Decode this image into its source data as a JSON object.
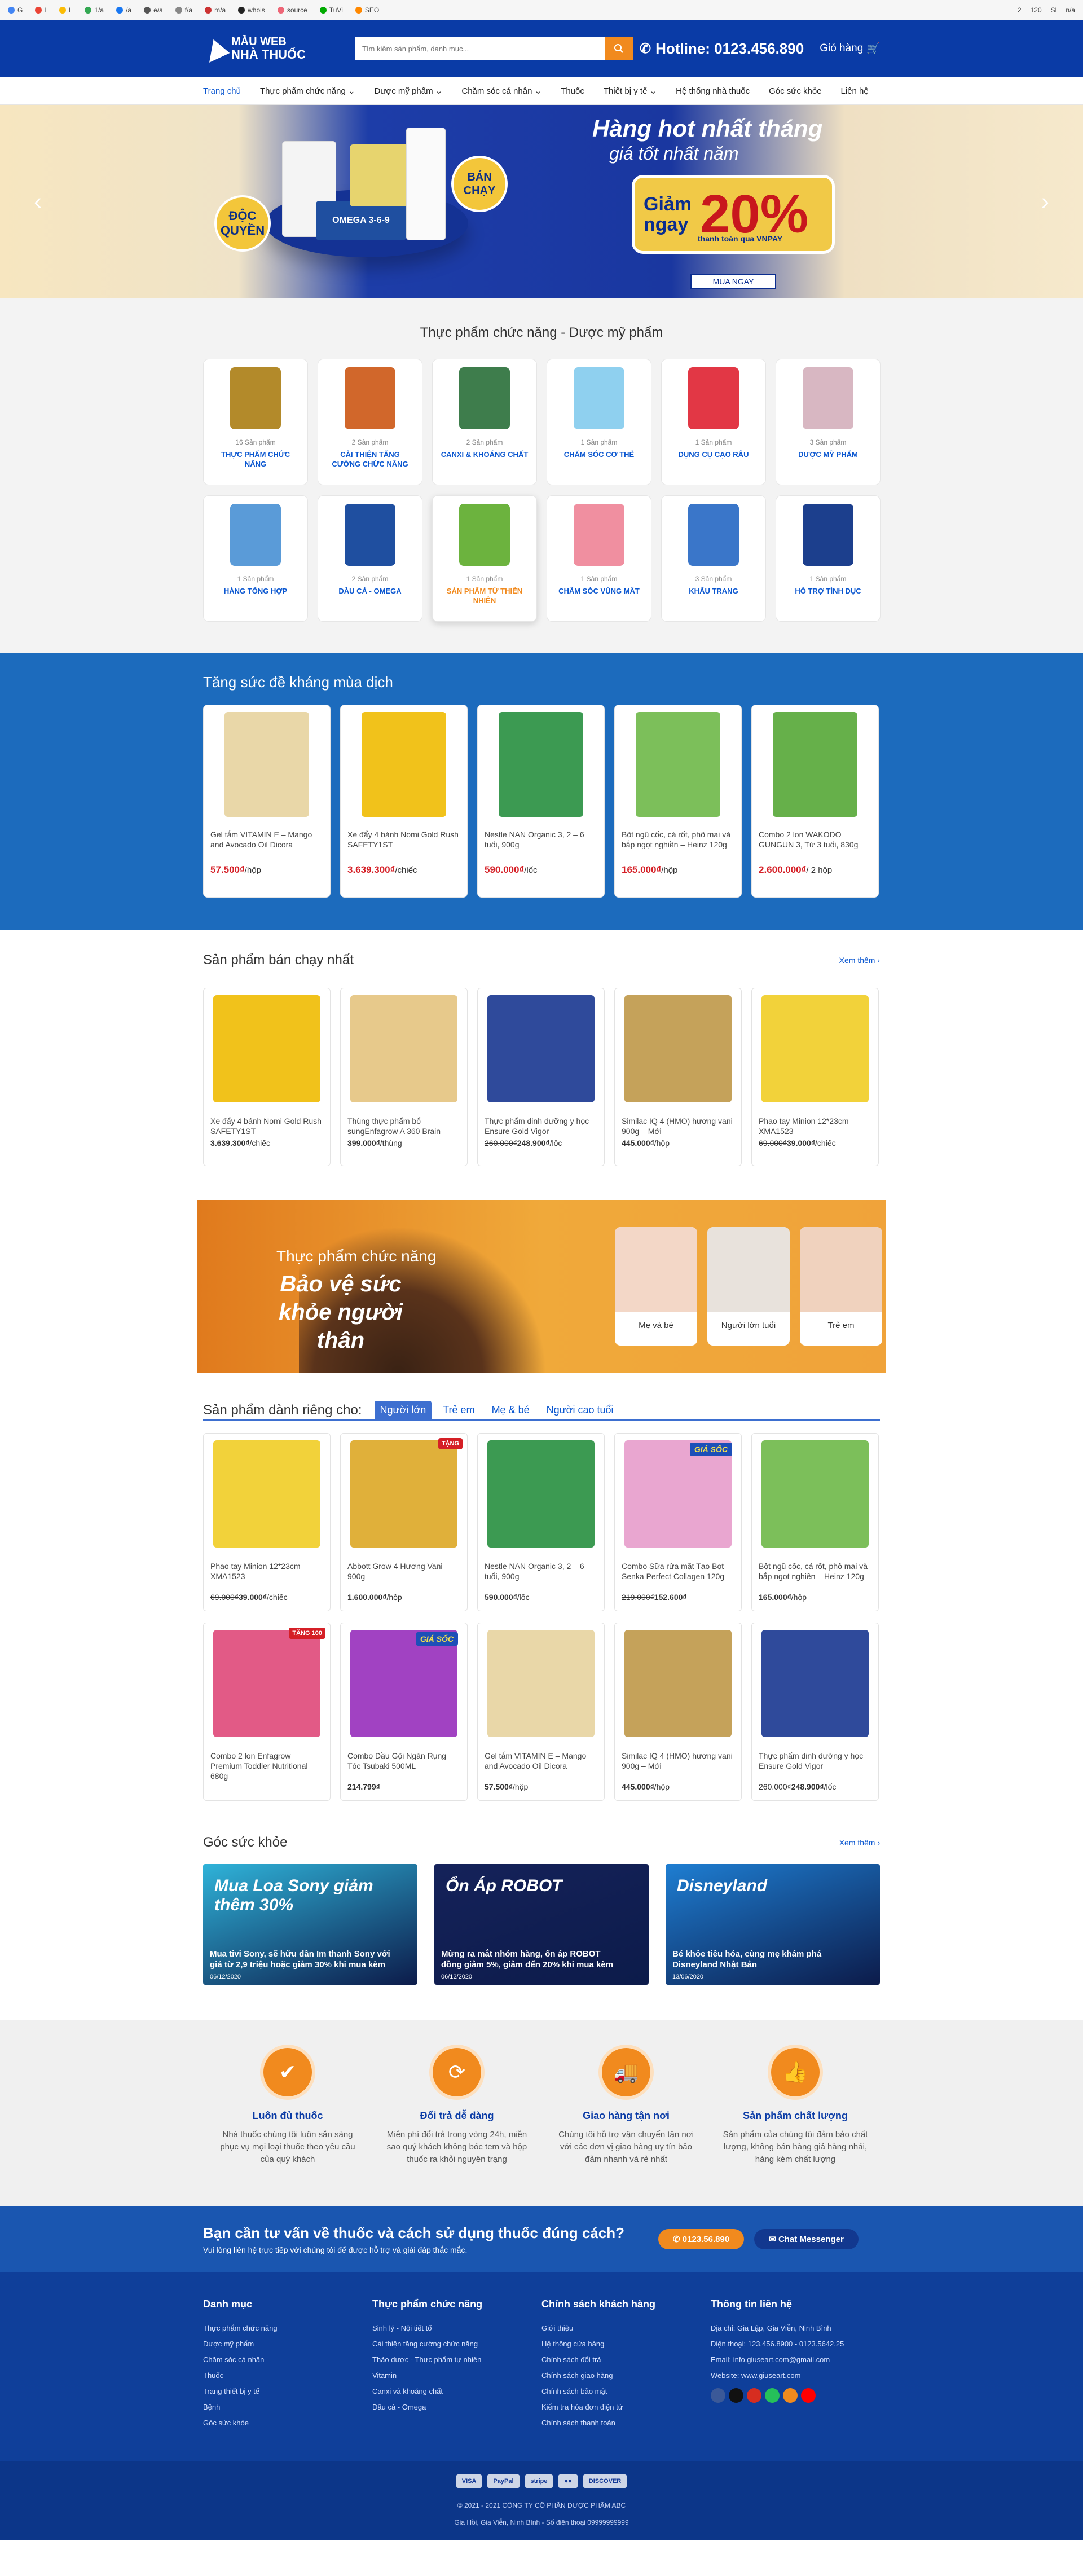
{
  "bookmarks": [
    "G",
    "I",
    "L",
    "1/a",
    "/a",
    "e/a",
    "f/a",
    "m/a",
    "whois",
    "source",
    "TuVi",
    "SEO"
  ],
  "bookmarks_right": [
    "2",
    "120",
    "Sl",
    "n/a"
  ],
  "header": {
    "logo_line1": "MẪU WEB",
    "logo_line2": "NHÀ THUỐC",
    "search_placeholder": "Tìm kiếm sản phẩm, danh mục...",
    "hotline": "Hotline: 0123.456.890",
    "cart": "Giỏ hàng"
  },
  "nav": [
    "Trang chủ",
    "Thực phẩm chức năng ⌄",
    "Dược mỹ phẩm ⌄",
    "Chăm sóc cá nhân ⌄",
    "Thuốc",
    "Thiết bị y tế ⌄",
    "Hệ thống nhà thuốc",
    "Góc sức khỏe",
    "Liên hệ"
  ],
  "banner": {
    "badge_left": "ĐỘC QUYỀN",
    "badge_right": "BÁN CHẠY",
    "headline": "Hàng hot nhất tháng",
    "subline": "giá tốt nhất năm",
    "promo_word": "Giảm ngay",
    "promo_value": "20%",
    "promo_note": "thanh toán qua VNPAY",
    "cta": "MUA NGAY",
    "product_label": "OMEGA 3-6-9"
  },
  "categories_title": "Thực phẩm chức năng - Dược mỹ phẩm",
  "categories": [
    {
      "count": "16 Sản phẩm",
      "name": "THỰC PHẨM CHỨC NĂNG",
      "color": "#b38a2a"
    },
    {
      "count": "2 Sản phẩm",
      "name": "CẢI THIỆN TĂNG CƯỜNG CHỨC NĂNG",
      "color": "#d1672b"
    },
    {
      "count": "2 Sản phẩm",
      "name": "CANXI & KHOÁNG CHẤT",
      "color": "#3e7d4c"
    },
    {
      "count": "1 Sản phẩm",
      "name": "CHĂM SÓC CƠ THỂ",
      "color": "#8fd0ef"
    },
    {
      "count": "1 Sản phẩm",
      "name": "DỤNG CỤ CẠO RÂU",
      "color": "#e23745"
    },
    {
      "count": "3 Sản phẩm",
      "name": "DƯỢC MỸ PHẨM",
      "color": "#d8b7c2"
    },
    {
      "count": "1 Sản phẩm",
      "name": "HÀNG TỔNG HỢP",
      "color": "#5a9bd8"
    },
    {
      "count": "2 Sản phẩm",
      "name": "DẦU CÁ - OMEGA",
      "color": "#1f4fa0"
    },
    {
      "count": "1 Sản phẩm",
      "name": "SẢN PHẨM TỪ THIÊN NHIÊN",
      "color": "#6cb33e",
      "active": true
    },
    {
      "count": "1 Sản phẩm",
      "name": "CHĂM SÓC VÙNG MẮT",
      "color": "#f08fa0"
    },
    {
      "count": "3 Sản phẩm",
      "name": "KHẨU TRANG",
      "color": "#3a76c9"
    },
    {
      "count": "1 Sản phẩm",
      "name": "HỖ TRỢ TÌNH DỤC",
      "color": "#1c3f8d"
    }
  ],
  "immunity": {
    "title": "Tăng sức đề kháng mùa dịch",
    "items": [
      {
        "name": "Gel tắm VITAMIN E – Mango and Avocado Oil Dicora",
        "price": "57.500₫",
        "unit": "/hộp",
        "color": "#e9d7a8"
      },
      {
        "name": "Xe đẩy 4 bánh Nomi Gold Rush SAFETY1ST",
        "price": "3.639.300₫",
        "unit": "/chiếc",
        "color": "#f1c21b"
      },
      {
        "name": "Nestle NAN Organic 3, 2 – 6 tuổi, 900g",
        "price": "590.000₫",
        "unit": "/lốc",
        "color": "#3c9a52"
      },
      {
        "name": "Bột ngũ cốc, cá rốt, phô mai và bắp ngọt nghiền – Heinz 120g",
        "price": "165.000₫",
        "unit": "/hộp",
        "color": "#7cbf5a"
      },
      {
        "name": "Combo 2 lon WAKODO GUNGUN 3, Từ 3 tuổi, 830g",
        "price": "2.600.000₫",
        "unit": "/ 2 hộp",
        "color": "#66b04a"
      }
    ]
  },
  "bestsellers": {
    "title": "Sản phẩm bán chạy nhất",
    "more": "Xem thêm ›",
    "items": [
      {
        "name": "Xe đẩy 4 bánh Nomi Gold Rush SAFETY1ST",
        "old": "",
        "price": "3.639.300₫",
        "unit": "/chiếc",
        "color": "#f1c21b"
      },
      {
        "name": "Thùng thực phẩm bổ sungEnfagrow A 360 Brain",
        "old": "",
        "price": "399.000₫",
        "unit": "/thùng",
        "color": "#e7c98b"
      },
      {
        "name": "Thực phẩm dinh dưỡng y học Ensure Gold Vigor",
        "old": "260.000₫",
        "price": "248.900₫",
        "unit": "/lốc",
        "color": "#2f4a9b"
      },
      {
        "name": "Similac IQ 4 (HMO) hương vani 900g – Mới",
        "old": "",
        "price": "445.000₫",
        "unit": "/hộp",
        "color": "#c5a25a"
      },
      {
        "name": "Phao tay Minion 12*23cm XMA1523",
        "old": "69.000₫",
        "price": "39.000₫",
        "unit": "/chiếc",
        "color": "#f2d23a"
      }
    ]
  },
  "family": {
    "line1": "Thực phẩm chức năng",
    "line2": "Bảo vệ sức khỏe người thân",
    "cards": [
      "Mẹ và bé",
      "Người lớn tuổi",
      "Trẻ em"
    ]
  },
  "dedicated": {
    "title": "Sản phẩm dành riêng cho:",
    "tabs": [
      "Người lớn",
      "Trẻ em",
      "Mẹ & bé",
      "Người cao tuổi"
    ],
    "items": [
      {
        "name": "Phao tay Minion 12*23cm XMA1523",
        "old": "69.000₫",
        "price": "39.000₫",
        "unit": "/chiếc",
        "color": "#f2d23a",
        "badge": ""
      },
      {
        "name": "Abbott Grow 4 Hương Vani 900g",
        "old": "",
        "price": "1.600.000₫",
        "unit": "/hộp",
        "color": "#e0b03a",
        "badge": "TẶNG"
      },
      {
        "name": "Nestle NAN Organic 3, 2 – 6 tuổi, 900g",
        "old": "",
        "price": "590.000₫",
        "unit": "/lốc",
        "color": "#3c9a52",
        "badge": ""
      },
      {
        "name": "Combo Sữa rửa mặt Tạo Bọt Senka Perfect Collagen 120g",
        "old": "219.000₫",
        "price": "152.600₫",
        "unit": "",
        "color": "#e9a6d0",
        "badge": "GIÁ SỐC"
      },
      {
        "name": "Bột ngũ cốc, cá rốt, phô mai và bắp ngọt nghiền – Heinz 120g",
        "old": "",
        "price": "165.000₫",
        "unit": "/hộp",
        "color": "#7cbf5a",
        "badge": ""
      },
      {
        "name": "Combo 2 lon Enfagrow Premium Toddler Nutritional 680g",
        "old": "",
        "price": "",
        "unit": "",
        "color": "#e25a86",
        "badge": "TẶNG 100"
      },
      {
        "name": "Combo Dầu Gội Ngăn Rụng Tóc Tsubaki 500ML",
        "old": "",
        "price": "214.799₫",
        "unit": "",
        "color": "#a142c2",
        "badge": "GIÁ SỐC"
      },
      {
        "name": "Gel tắm VITAMIN E – Mango and Avocado Oil Dicora",
        "old": "",
        "price": "57.500₫",
        "unit": "/hộp",
        "color": "#e9d7a8",
        "badge": ""
      },
      {
        "name": "Similac IQ 4 (HMO) hương vani 900g – Mới",
        "old": "",
        "price": "445.000₫",
        "unit": "/hộp",
        "color": "#c5a25a",
        "badge": ""
      },
      {
        "name": "Thực phẩm dinh dưỡng y học Ensure Gold Vigor",
        "old": "260.000₫",
        "price": "248.900₫",
        "unit": "/lốc",
        "color": "#2f4a9b",
        "badge": ""
      }
    ]
  },
  "health": {
    "title": "Góc sức khỏe",
    "more": "Xem thêm ›",
    "posts": [
      {
        "title": "Mua tivi Sony, sẽ hữu dần Im thanh Sony với giá từ 2,9 triệu hoặc giảm 30% khi mua kèm",
        "date": "06/12/2020",
        "headline": "Mua Loa Sony giảm thêm 30%",
        "color": "#2fb3d9"
      },
      {
        "title": "Mừng ra mắt nhóm hàng, ổn áp ROBOT đồng giảm 5%, giảm đến 20% khi mua kèm",
        "date": "06/12/2020",
        "headline": "Ổn Áp ROBOT",
        "color": "#15225a"
      },
      {
        "title": "Bé khỏe tiêu hóa, cùng mẹ khám phá Disneyland Nhật Bản",
        "date": "13/06/2020",
        "headline": "Disneyland",
        "color": "#1e7ed2"
      }
    ]
  },
  "features": [
    {
      "title": "Luôn đủ thuốc",
      "text": "Nhà thuốc chúng tôi luôn sẵn sàng phục vụ mọi loại thuốc theo yêu cầu của quý khách",
      "icon": "✔"
    },
    {
      "title": "Đổi trả dễ dàng",
      "text": "Miễn phí đổi trả trong vòng 24h, miễn sao quý khách không bóc tem và hộp thuốc ra khỏi nguyên trạng",
      "icon": "⟳"
    },
    {
      "title": "Giao hàng tận nơi",
      "text": "Chúng tôi hỗ trợ vận chuyển tận nơi với các đơn vị giao hàng uy tín bảo đảm nhanh và rẻ nhất",
      "icon": "🚚"
    },
    {
      "title": "Sản phẩm chất lượng",
      "text": "Sản phẩm của chúng tôi đảm bảo chất lượng, không bán hàng giả hàng nhái, hàng kém chất lượng",
      "icon": "👍"
    }
  ],
  "cta": {
    "title": "Bạn cần tư vấn về thuốc và cách sử dụng thuốc đúng cách?",
    "text": "Vui lòng liên hệ trực tiếp với chúng tôi để được hỗ trợ và giải đáp thắc mắc.",
    "phone": "0123.56.890",
    "chat": "Chat Messenger"
  },
  "footer": {
    "cols": [
      {
        "title": "Danh mục",
        "items": [
          "Thực phẩm chức năng",
          "Dược mỹ phẩm",
          "Chăm sóc cá nhân",
          "Thuốc",
          "Trang thiết bị y tế",
          "Bệnh",
          "Góc sức khỏe"
        ]
      },
      {
        "title": "Thực phẩm chức năng",
        "items": [
          "Sinh lý - Nội tiết tố",
          "Cải thiện tăng cường chức năng",
          "Thảo dược - Thực phẩm tự nhiên",
          "Vitamin",
          "Canxi và khoáng chất",
          "Dầu cá - Omega"
        ]
      },
      {
        "title": "Chính sách khách hàng",
        "items": [
          "Giới thiệu",
          "Hệ thống cửa hàng",
          "Chính sách đổi trả",
          "Chính sách giao hàng",
          "Chính sách bảo mật",
          "Kiểm tra hóa đơn điện tử",
          "Chính sách thanh toán"
        ]
      },
      {
        "title": "Thông tin liên hệ",
        "items": [
          "Địa chỉ: Gia Lập, Gia Viễn, Ninh Bình",
          "Điện thoại: 123.456.8900 - 0123.5642.25",
          "Email: info.giuseart.com@gmail.com",
          "Website: www.giuseart.com"
        ]
      }
    ],
    "social_colors": [
      "#3b5998",
      "#111",
      "#d62d20",
      "#25c05a",
      "#f08a1e",
      "#ff0000"
    ],
    "payments": [
      "VISA",
      "PayPal",
      "stripe",
      "●●",
      "DISCOVER"
    ],
    "copyright": "© 2021 - 2021 CÔNG TY CỔ PHẦN DƯỢC PHẨM ABC",
    "address": "Gia Hồi, Gia Viễn, Ninh Bình - Số điện thoại 09999999999"
  }
}
